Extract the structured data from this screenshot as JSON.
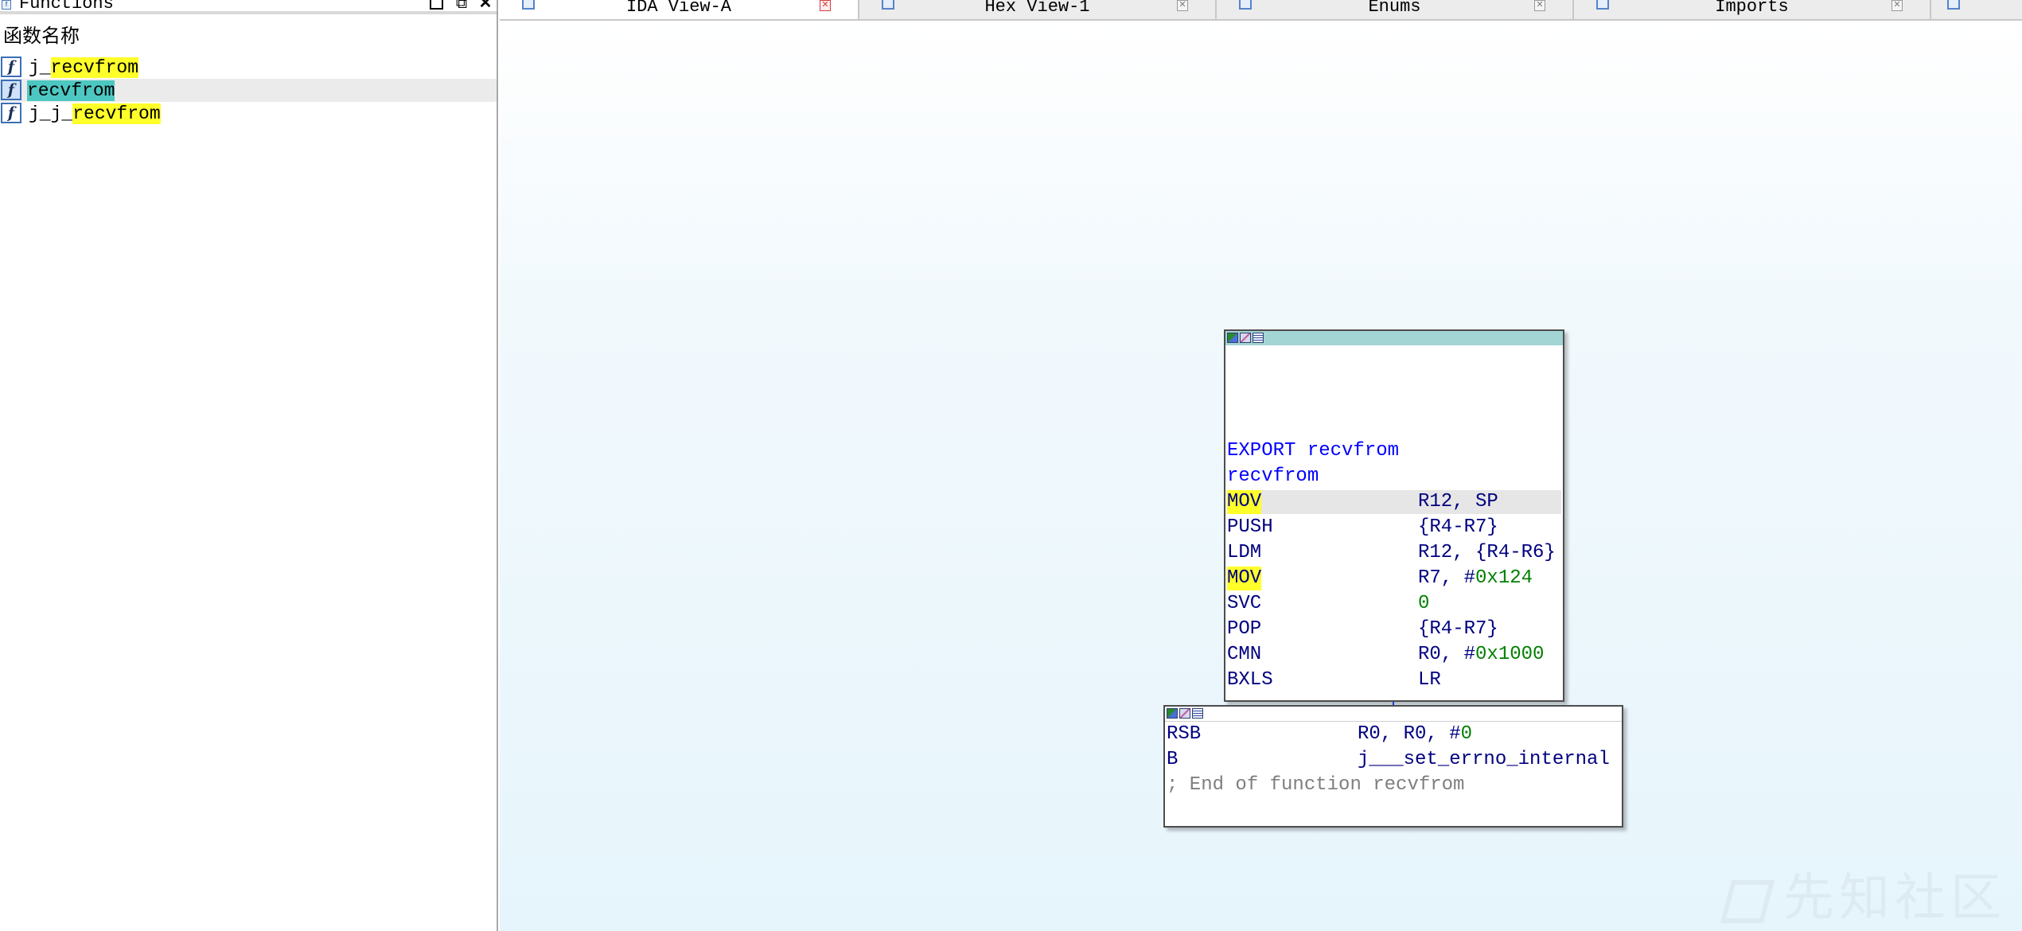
{
  "functions_panel": {
    "title": "Functions",
    "restore_icon": "restore-window-icon",
    "float_icon": "float-window-icon",
    "close_icon": "close-icon",
    "column_header": "函数名称",
    "rows": [
      {
        "prefix": "j_",
        "highlight": "recvfrom",
        "suffix": "",
        "selected": false,
        "icon": "function-icon"
      },
      {
        "prefix": "",
        "highlight": "recvfrom",
        "suffix": "",
        "selected": true,
        "icon": "function-icon"
      },
      {
        "prefix": "j_j_",
        "highlight": "recvfrom",
        "suffix": "",
        "selected": false,
        "icon": "function-icon"
      }
    ],
    "highlight_color": "#ffff2a",
    "selected_highlight_color": "#4dc7c1"
  },
  "tabs": [
    {
      "label": "IDA View-A",
      "active": true,
      "icon": "ida-view-icon"
    },
    {
      "label": "Hex View-1",
      "active": false,
      "icon": "hex-view-icon"
    },
    {
      "label": "Enums",
      "active": false,
      "icon": "enums-icon"
    },
    {
      "label": "Imports",
      "active": false,
      "icon": "imports-icon"
    }
  ],
  "graph": {
    "block1": {
      "lines": [
        {
          "type": "label",
          "text": "EXPORT recvfrom"
        },
        {
          "type": "label",
          "text": "recvfrom"
        },
        {
          "type": "insn",
          "mnem": "MOV",
          "ops": "R12, SP",
          "mnem_highlight": true,
          "current": true
        },
        {
          "type": "insn",
          "mnem": "PUSH",
          "ops": "{R4-R7}",
          "mnem_highlight": false,
          "current": false
        },
        {
          "type": "insn",
          "mnem": "LDM",
          "ops": "R12, {R4-R6}",
          "mnem_highlight": false,
          "current": false
        },
        {
          "type": "insn",
          "mnem": "MOV",
          "ops_pre": "R7, #",
          "ops_num": "0x124",
          "mnem_highlight": true,
          "current": false
        },
        {
          "type": "insn",
          "mnem": "SVC",
          "ops_pre": "",
          "ops_num": "0",
          "mnem_highlight": false,
          "current": false
        },
        {
          "type": "insn",
          "mnem": "POP",
          "ops": "{R4-R7}",
          "mnem_highlight": false,
          "current": false
        },
        {
          "type": "insn",
          "mnem": "CMN",
          "ops_pre": "R0, #",
          "ops_num": "0x1000",
          "mnem_highlight": false,
          "current": false
        },
        {
          "type": "insn",
          "mnem": "BXLS",
          "ops": "LR",
          "mnem_highlight": false,
          "current": false
        }
      ]
    },
    "block2": {
      "lines": [
        {
          "type": "insn",
          "mnem": "RSB",
          "ops_pre": "R0, R0, #",
          "ops_num": "0"
        },
        {
          "type": "insn",
          "mnem": "B",
          "ops": "j___set_errno_internal"
        },
        {
          "type": "comment",
          "text": "; End of function recvfrom"
        }
      ]
    },
    "edge_color": "#1a3fe0",
    "number_color": "#008000",
    "instruction_color": "#000080"
  },
  "watermark": {
    "text": "先知社区"
  }
}
